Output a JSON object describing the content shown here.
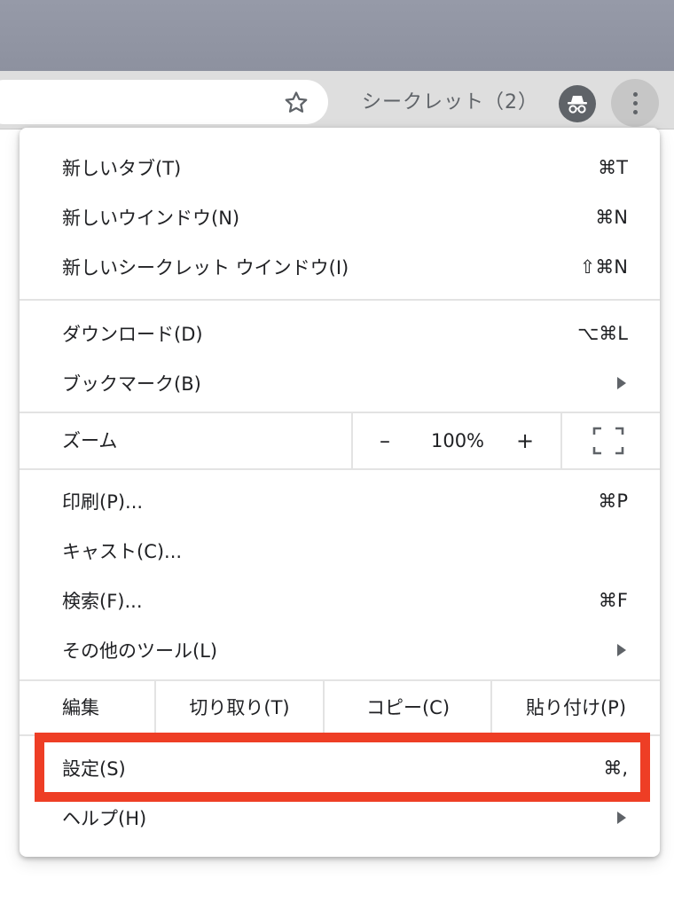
{
  "toolbar": {
    "incognito_label": "シークレット（2）"
  },
  "menu": {
    "new_tab": {
      "label": "新しいタブ(T)",
      "shortcut": "⌘T"
    },
    "new_window": {
      "label": "新しいウインドウ(N)",
      "shortcut": "⌘N"
    },
    "new_incognito": {
      "label": "新しいシークレット ウインドウ(I)",
      "shortcut": "⇧⌘N"
    },
    "downloads": {
      "label": "ダウンロード(D)",
      "shortcut": "⌥⌘L"
    },
    "bookmarks": {
      "label": "ブックマーク(B)"
    },
    "zoom": {
      "label": "ズーム",
      "minus": "–",
      "value": "100%",
      "plus": "+"
    },
    "print": {
      "label": "印刷(P)...",
      "shortcut": "⌘P"
    },
    "cast": {
      "label": "キャスト(C)..."
    },
    "find": {
      "label": "検索(F)...",
      "shortcut": "⌘F"
    },
    "more_tools": {
      "label": "その他のツール(L)"
    },
    "edit": {
      "label": "編集",
      "cut": "切り取り(T)",
      "copy": "コピー(C)",
      "paste": "貼り付け(P)"
    },
    "settings": {
      "label": "設定(S)",
      "shortcut": "⌘,"
    },
    "help": {
      "label": "ヘルプ(H)"
    }
  },
  "colors": {
    "highlight": "#ee3e25",
    "icon": "#5f6368",
    "separator": "#e3e3e3"
  }
}
